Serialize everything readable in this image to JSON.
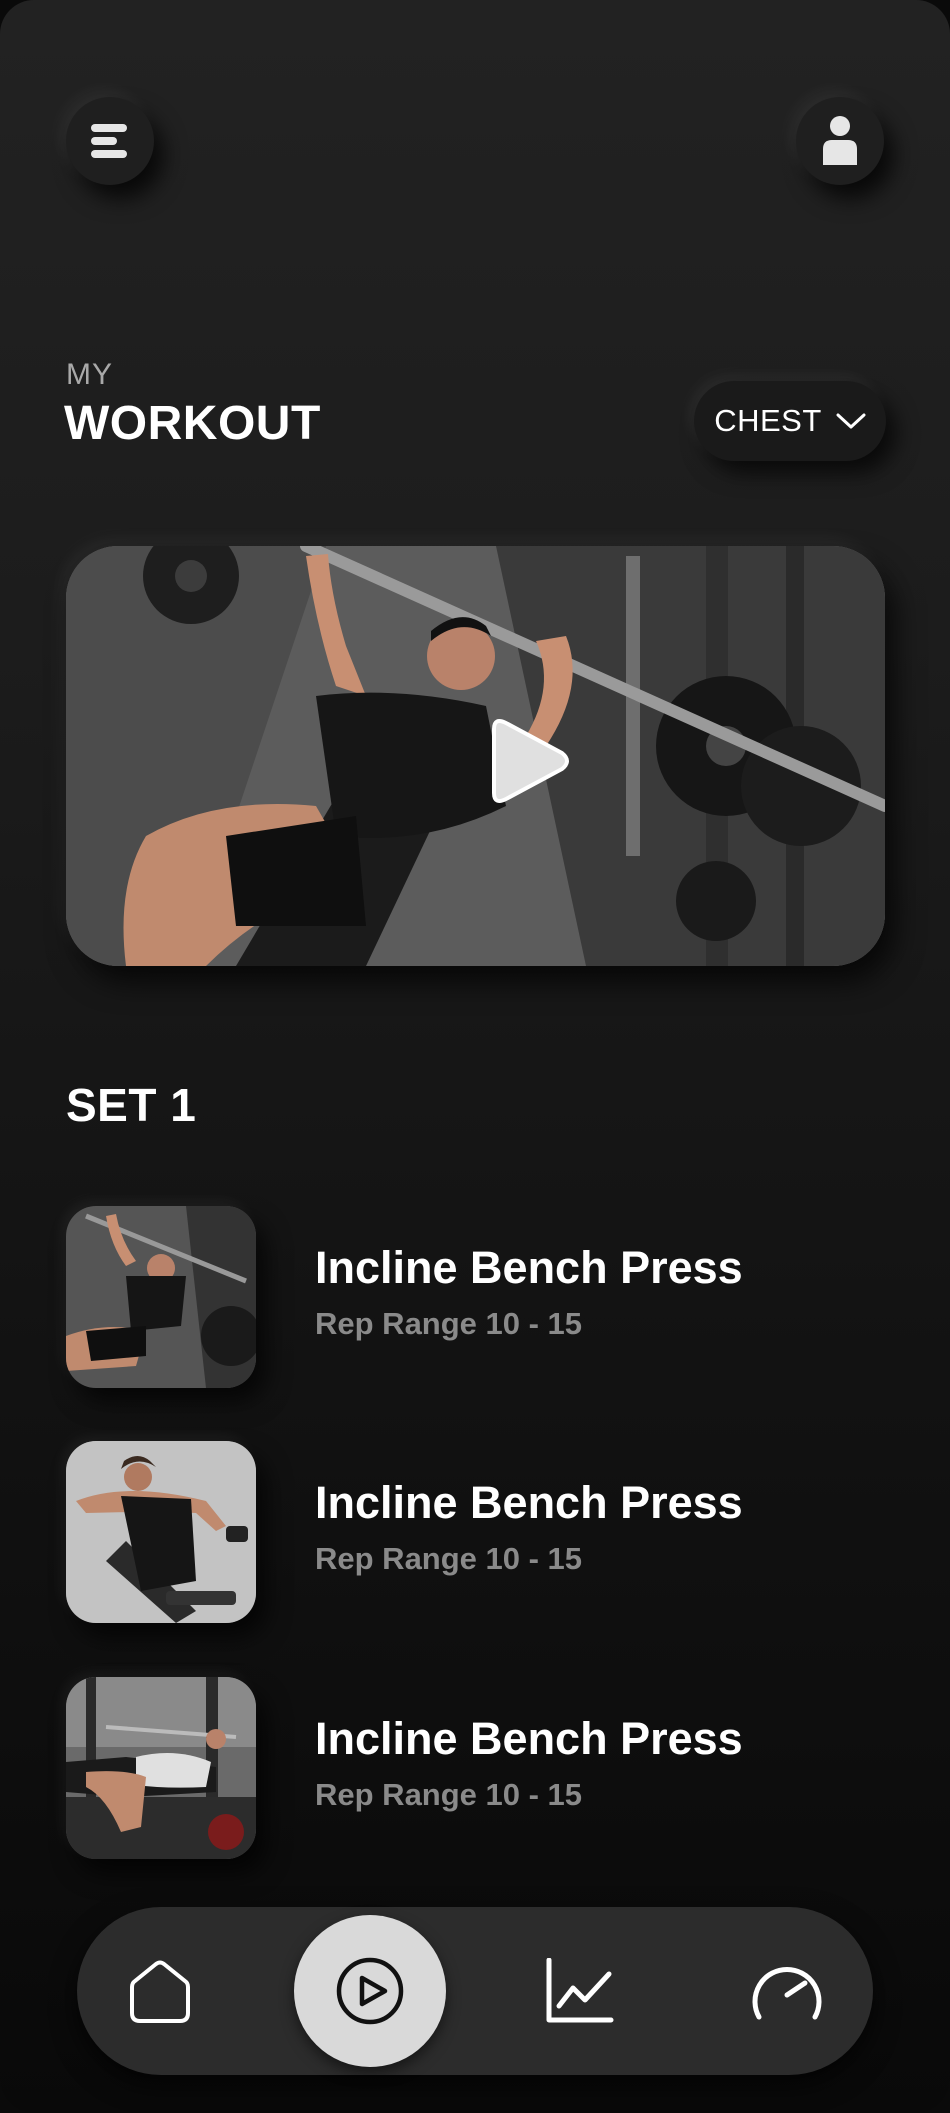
{
  "header": {
    "small_title": "MY",
    "big_title": "WORKOUT",
    "menu_icon": "menu-icon",
    "profile_icon": "user-icon"
  },
  "filter": {
    "selected": "CHEST",
    "icon": "chevron-down-icon"
  },
  "hero": {
    "icon": "play-icon"
  },
  "set": {
    "title": "SET 1",
    "exercises": [
      {
        "name": "Incline Bench Press",
        "range": "Rep Range 10 - 15"
      },
      {
        "name": "Incline Bench Press",
        "range": "Rep Range 10 - 15"
      },
      {
        "name": "Incline Bench Press",
        "range": "Rep Range 10 - 15"
      }
    ]
  },
  "nav": {
    "items": [
      {
        "icon": "home-icon",
        "active": false
      },
      {
        "icon": "play-icon",
        "active": true
      },
      {
        "icon": "chart-icon",
        "active": false
      },
      {
        "icon": "speedometer-icon",
        "active": false
      }
    ]
  },
  "colors": {
    "background_top": "#222222",
    "background_bottom": "#090909",
    "nav_bar": "#2c2c2c",
    "nav_active": "#d9d9d9",
    "text_primary": "#ffffff",
    "text_secondary": "#8a8a8a"
  }
}
